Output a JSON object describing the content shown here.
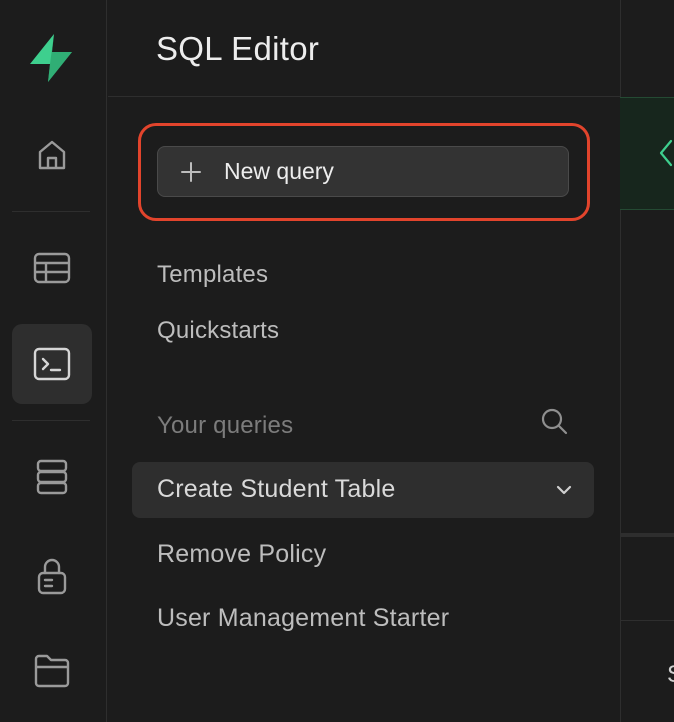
{
  "rail": {
    "items": [
      {
        "icon": "home-icon"
      },
      {
        "icon": "table-editor-icon"
      },
      {
        "icon": "sql-editor-icon",
        "active": true
      },
      {
        "icon": "database-icon"
      },
      {
        "icon": "auth-lock-icon"
      },
      {
        "icon": "storage-folder-icon"
      }
    ]
  },
  "panel": {
    "title": "SQL Editor",
    "new_query_label": "New query",
    "links": [
      "Templates",
      "Quickstarts"
    ],
    "your_queries_label": "Your queries",
    "queries": [
      "Create Student Table",
      "Remove Policy",
      "User Management Starter"
    ]
  },
  "editor": {
    "partial_text": "S"
  },
  "colors": {
    "background": "#1c1c1c",
    "accent_green": "#3ecf8e",
    "highlight_red": "#e2442c",
    "selected_row": "#2e2e2e"
  }
}
